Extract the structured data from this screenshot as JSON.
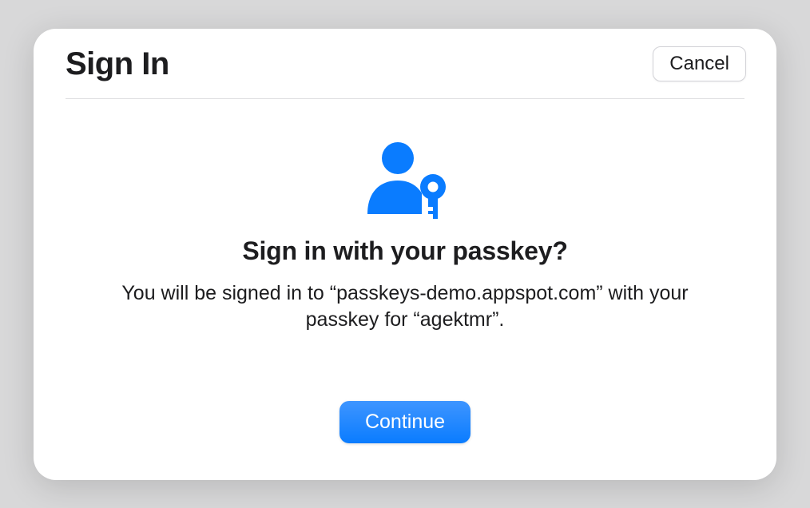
{
  "header": {
    "title": "Sign In",
    "cancel_label": "Cancel"
  },
  "body": {
    "icon_name": "passkey-user-icon",
    "heading": "Sign in with your passkey?",
    "description": "You will be signed in to “passkeys-demo.appspot.com” with your passkey for “agektmr”."
  },
  "footer": {
    "continue_label": "Continue"
  },
  "colors": {
    "accent": "#0a7cff",
    "background_page": "#d8d8d9",
    "dialog_background": "#ffffff",
    "text_primary": "#1d1d1f",
    "divider": "#e0e0e2"
  }
}
